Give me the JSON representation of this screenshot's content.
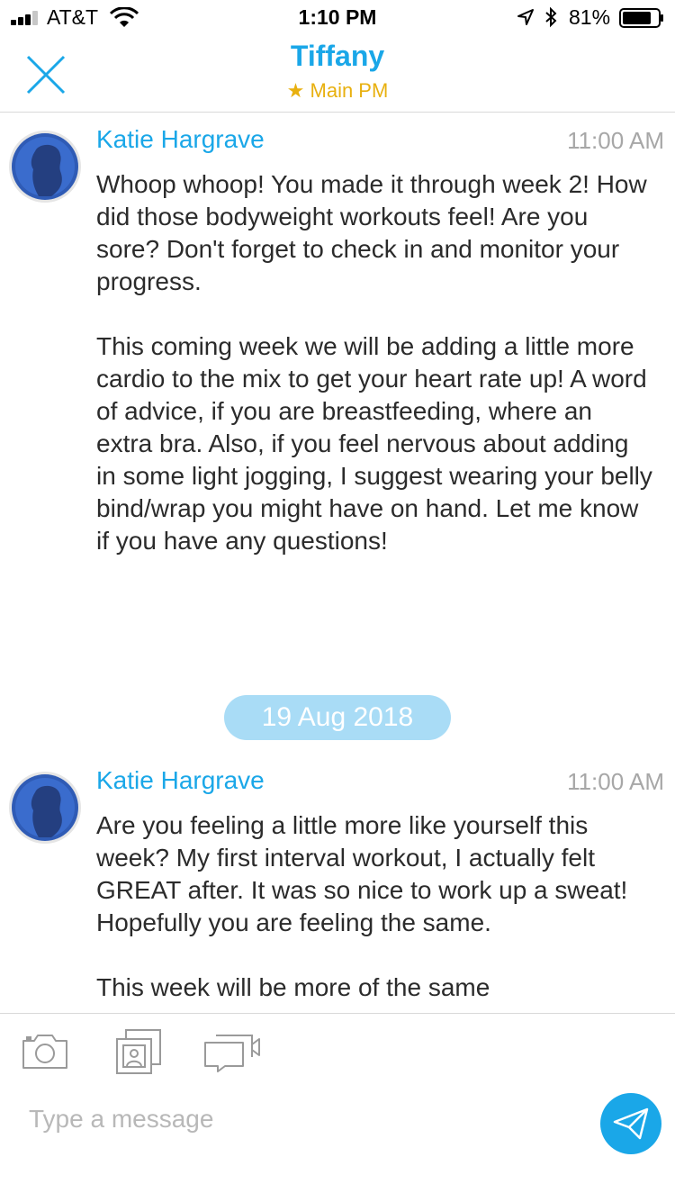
{
  "status_bar": {
    "carrier": "AT&T",
    "time": "1:10 PM",
    "battery": "81%",
    "battery_level": 0.81
  },
  "header": {
    "title": "Tiffany",
    "subtitle": "★ Main PM"
  },
  "messages": [
    {
      "sender": "Katie Hargrave",
      "time": "11:00 AM",
      "text": "Whoop whoop! You made it through week 2! How did those bodyweight workouts feel! Are you sore? Don't forget to check in and monitor your progress.\n\nThis coming week we will be adding a little more cardio to the mix to get your heart rate up! A word of advice, if you are breastfeeding, where an extra bra. Also, if you feel nervous about adding in some light jogging, I suggest wearing your belly bind/wrap you might have on hand. Let me know if you have any questions!"
    },
    {
      "sender": "Katie Hargrave",
      "time": "11:00 AM",
      "text": "Are you feeling a little more like yourself this week? My first interval workout, I actually felt GREAT after. It was so nice to work up a sweat! Hopefully you are feeling the same.\n\nThis week will be more of the same"
    }
  ],
  "date_separator": "19 Aug 2018",
  "composer": {
    "placeholder": "Type a message",
    "value": ""
  },
  "icons": {
    "close": "close-icon",
    "camera": "camera-icon",
    "photo": "photo-library-icon",
    "video": "video-icon",
    "send": "send-icon"
  },
  "colors": {
    "accent": "#1aa7e8",
    "star": "#e8b00f",
    "date_pill": "#a9dcf6",
    "time_text": "#a7a7a7"
  }
}
